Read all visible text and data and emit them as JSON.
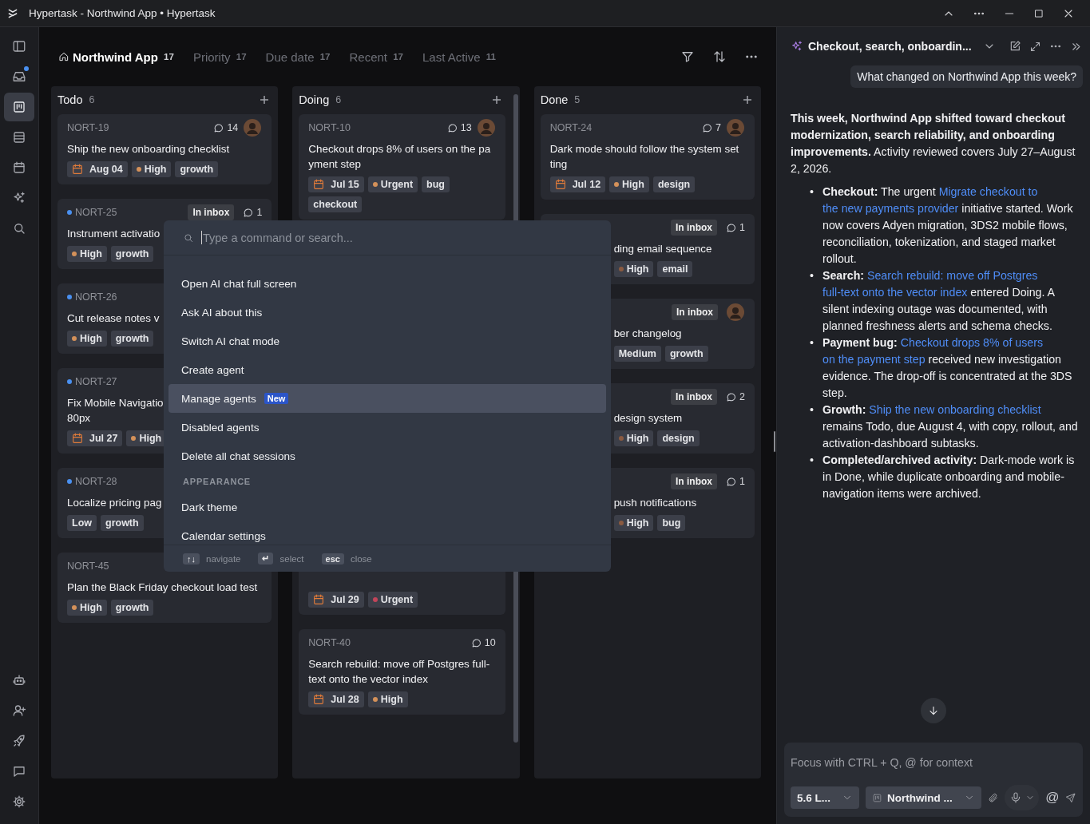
{
  "window": {
    "title": "Hypertask - Northwind App • Hypertask"
  },
  "sidebar": {
    "top": [
      {
        "selected": false,
        "unread": false
      },
      {
        "selected": false,
        "unread": true
      },
      {
        "selected": true,
        "unread": false
      },
      {
        "selected": false,
        "unread": false
      },
      {
        "selected": false,
        "unread": false
      },
      {
        "selected": false,
        "unread": false
      },
      {
        "selected": false,
        "unread": false
      }
    ],
    "bottom": [
      {
        "selected": false
      },
      {
        "selected": false
      },
      {
        "selected": false
      },
      {
        "selected": false
      },
      {
        "selected": false
      }
    ]
  },
  "views": [
    {
      "label": "Northwind App",
      "count": "17",
      "selected": true
    },
    {
      "label": "Priority",
      "count": "17",
      "selected": false
    },
    {
      "label": "Due date",
      "count": "17",
      "selected": false
    },
    {
      "label": "Recent",
      "count": "17",
      "selected": false
    },
    {
      "label": "Last Active",
      "count": "11",
      "selected": false
    }
  ],
  "columns": [
    {
      "title": "Todo",
      "count": "6",
      "cards": [
        {
          "kind": "full",
          "id": "NORT-19",
          "unread": false,
          "comments": "14",
          "avatar": true,
          "title": "Ship the new onboarding checklist",
          "date": "Aug 04",
          "priority": {
            "label": "High",
            "color": "#d4915a"
          },
          "tags": [
            "growth"
          ]
        },
        {
          "kind": "full",
          "id": "NORT-25",
          "unread": true,
          "inbox": "In inbox",
          "comments": "1",
          "avatar": false,
          "title": "Instrument activatio",
          "priority": {
            "label": "High",
            "color": "#d4915a"
          },
          "tags": [
            "growth"
          ]
        },
        {
          "kind": "full",
          "id": "NORT-26",
          "unread": true,
          "avatar": false,
          "title": "Cut release notes v",
          "priority": {
            "label": "High",
            "color": "#d4915a"
          },
          "tags": [
            "growth"
          ]
        },
        {
          "kind": "full",
          "id": "NORT-27",
          "unread": true,
          "avatar": false,
          "title": "Fix Mobile Navigatio\n80px",
          "date": "Jul 27",
          "priority": {
            "label": "High",
            "color": "#d4915a"
          }
        },
        {
          "kind": "full",
          "id": "NORT-28",
          "unread": true,
          "avatar": false,
          "title": "Localize pricing pag",
          "priority": {
            "label": "Low"
          },
          "tags": [
            "growth"
          ]
        },
        {
          "kind": "full",
          "id": "NORT-45",
          "unread": false,
          "avatar": false,
          "title": "Plan the Black Friday checkout load test",
          "priority": {
            "label": "High",
            "color": "#d4915a"
          },
          "tags": [
            "growth"
          ]
        }
      ]
    },
    {
      "title": "Doing",
      "count": "6",
      "cards": [
        {
          "kind": "full",
          "id": "NORT-10",
          "unread": false,
          "comments": "13",
          "avatar": true,
          "title": "Checkout drops 8% of users on the pa\nyment step",
          "date": "Jul 15",
          "priority": {
            "label": "Urgent",
            "color": "#d4915a"
          },
          "tags": [
            "bug",
            "checkout"
          ]
        },
        {
          "kind": "covered",
          "unread": false,
          "avatar": false,
          "date": "Jul 29",
          "priority": {
            "label": "Urgent",
            "color": "#c2455a"
          }
        },
        {
          "kind": "full",
          "id": "NORT-40",
          "unread": false,
          "comments": "10",
          "avatar": false,
          "title": "Search rebuild: move off Postgres full-\ntext onto the vector index",
          "date": "Jul 28",
          "priority": {
            "label": "High",
            "color": "#d4915a"
          }
        }
      ]
    },
    {
      "title": "Done",
      "count": "5",
      "cards": [
        {
          "kind": "full",
          "id": "NORT-24",
          "unread": false,
          "comments": "7",
          "avatar": true,
          "title": "Dark mode should follow the system set\nting",
          "date": "Jul 12",
          "priority": {
            "label": "High",
            "color": "#d4915a"
          },
          "tags": [
            "design"
          ]
        },
        {
          "kind": "covered_left",
          "unread": false,
          "inbox": "In inbox",
          "comments": "1",
          "avatar": false,
          "title": "ding email sequence",
          "priority": {
            "label": "High",
            "color": "#8a5a40"
          },
          "tags": [
            "email"
          ]
        },
        {
          "kind": "covered_left",
          "unread": false,
          "inbox": "In inbox",
          "avatar": true,
          "title": "ber changelog",
          "priority": {
            "label": "Medium"
          },
          "tags": [
            "growth"
          ]
        },
        {
          "kind": "covered_left",
          "unread": false,
          "inbox": "In inbox",
          "comments": "2",
          "avatar": false,
          "title": "design system",
          "priority": {
            "label": "High",
            "color": "#8a5a40"
          },
          "tags": [
            "design"
          ]
        },
        {
          "kind": "covered_left",
          "unread": false,
          "inbox": "In inbox",
          "comments": "1",
          "avatar": false,
          "title": "push notifications",
          "priority": {
            "label": "High",
            "color": "#8a5a40"
          },
          "tags": [
            "bug"
          ]
        }
      ]
    }
  ],
  "palette": {
    "placeholder": "Type a command or search...",
    "items": [
      {
        "kind": "command",
        "label": "Open AI chat full screen",
        "selected": false
      },
      {
        "kind": "command",
        "label": "Ask AI about this",
        "selected": false
      },
      {
        "kind": "command",
        "label": "Switch AI chat mode",
        "selected": false
      },
      {
        "kind": "command",
        "label": "Create agent",
        "selected": false
      },
      {
        "kind": "command",
        "label": "Manage agents",
        "badge": "New",
        "selected": true
      },
      {
        "kind": "command",
        "label": "Disabled agents",
        "selected": false
      },
      {
        "kind": "command",
        "label": "Delete all chat sessions",
        "selected": false
      },
      {
        "kind": "section",
        "label": "APPEARANCE"
      },
      {
        "kind": "command",
        "label": "Dark theme",
        "selected": false
      },
      {
        "kind": "command",
        "label": "Calendar settings",
        "selected": false
      }
    ],
    "hints": [
      {
        "key": "↑↓",
        "label": "navigate"
      },
      {
        "key": "↵",
        "label": "select"
      },
      {
        "key": "esc",
        "label": "close"
      }
    ]
  },
  "chat": {
    "title": "Checkout, search, onboardin...",
    "user_message": "What changed on Northwind App this week?",
    "summary": "**This week, Northwind App shifted toward checkout modernization, search reliability, and onboarding improvements.** Activity reviewed covers July 27–August 2, 2026.",
    "bullets": [
      {
        "marker": "•",
        "segments": [
          {
            "kind": "text",
            "text": "**Checkout:** The urgent "
          },
          {
            "kind": "link",
            "text": "Migrate checkout to"
          },
          {
            "kind": "link",
            "text": "the new payments provider"
          },
          {
            "kind": "text",
            "text": " initiative started. Work now covers Adyen migration, 3DS2 mobile flows, reconciliation, tokenization, and staged market rollout."
          }
        ]
      },
      {
        "marker": "•",
        "segments": [
          {
            "kind": "text",
            "text": "**Search:** "
          },
          {
            "kind": "link",
            "text": "Search rebuild: move off Postgres"
          },
          {
            "kind": "link",
            "text": "full-text onto the vector index"
          },
          {
            "kind": "text",
            "text": " entered Doing. A silent indexing outage was documented, with planned freshness alerts and schema checks."
          }
        ]
      },
      {
        "marker": "•",
        "segments": [
          {
            "kind": "text",
            "text": "**Payment bug:** "
          },
          {
            "kind": "link",
            "text": "Checkout drops 8% of users"
          },
          {
            "kind": "link",
            "text": "on the payment step"
          },
          {
            "kind": "text",
            "text": " received new investigation evidence. The drop-off is concentrated at the 3DS step."
          }
        ]
      },
      {
        "marker": "•",
        "segments": [
          {
            "kind": "text",
            "text": "**Growth:** "
          },
          {
            "kind": "link",
            "text": "Ship the new onboarding checklist"
          },
          {
            "kind": "text",
            "text": " remains Todo, due August 4, with copy, rollout, and activation-dashboard subtasks."
          }
        ]
      },
      {
        "marker": "•",
        "segments": [
          {
            "kind": "text",
            "text": "**Completed/archived activity:** Dark-mode work is in Done, while duplicate onboarding and mobile-navigation items were archived."
          }
        ]
      }
    ],
    "composer": {
      "placeholder": "Focus with CTRL + Q, @ for context",
      "model": "5.6 L...",
      "context": "Northwind ...",
      "mention": "@"
    }
  }
}
